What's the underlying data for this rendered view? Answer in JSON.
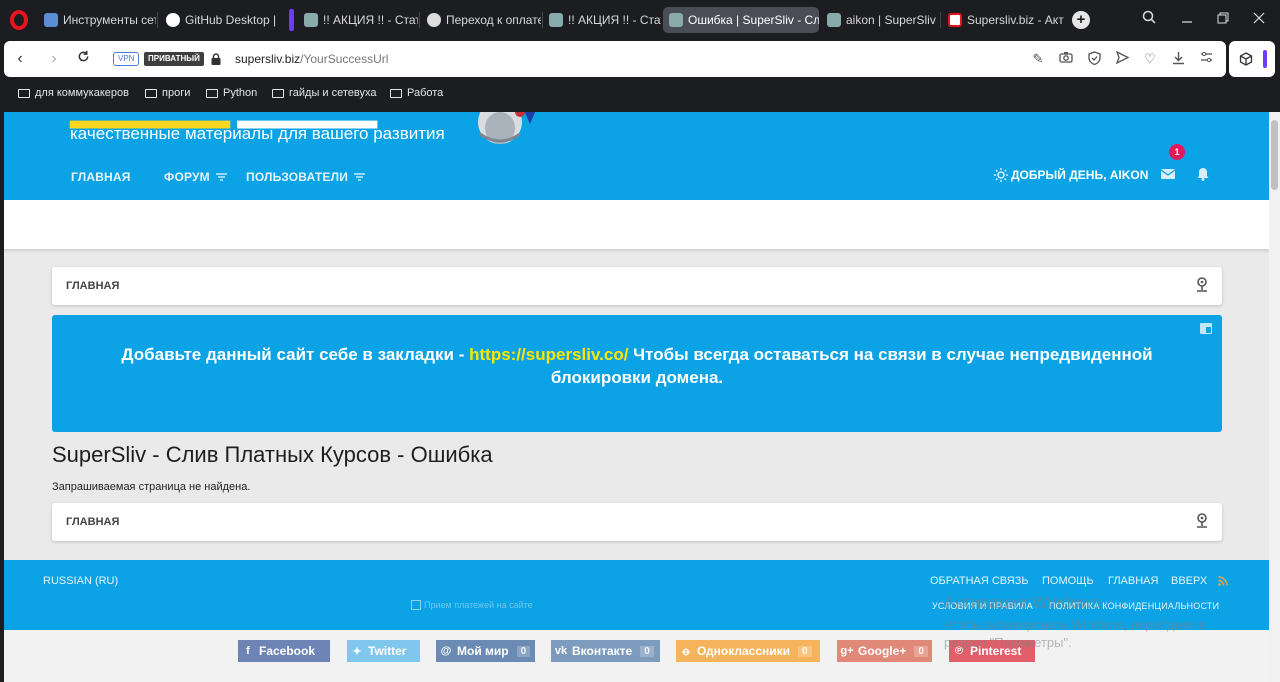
{
  "browser": {
    "tabs": [
      {
        "label": "Инструменты сете",
        "active": false
      },
      {
        "label": "GitHub Desktop | S",
        "active": false
      },
      {
        "label": "!! АКЦИЯ !! - Стат",
        "active": false
      },
      {
        "label": "Переход к оплате",
        "active": false
      },
      {
        "label": "!! АКЦИЯ !! - Стат",
        "active": false
      },
      {
        "label": "Ошибка | SuperSliv - Слив",
        "active": true
      },
      {
        "label": "aikon | SuperSliv -",
        "active": false
      },
      {
        "label": "Supersliv.biz - Акт",
        "active": false
      }
    ],
    "vpn_label": "VPN",
    "private_label": "ПРИВАТНЫЙ",
    "url_host": "supersliv.biz",
    "url_path": "/YourSuccessUrl",
    "bookmarks": [
      {
        "label": "для коммукакеров"
      },
      {
        "label": "проги"
      },
      {
        "label": "Python"
      },
      {
        "label": "гайды и сетевуха"
      },
      {
        "label": "Работа"
      }
    ]
  },
  "header": {
    "tagline": "качественные материалы для вашего развития",
    "nav": {
      "home": "ГЛАВНАЯ",
      "forum": "ФОРУМ",
      "users": "ПОЛЬЗОВАТЕЛИ"
    },
    "greeting": "ДОБРЫЙ ДЕНЬ, AIKON",
    "notification_count": "1"
  },
  "breadcrumb": {
    "label": "ГЛАВНАЯ"
  },
  "notice": {
    "text_before": "Добавьте данный сайт себе в закладки - ",
    "link": "https://supersliv.co/",
    "text_after": " Чтобы всегда оставаться на связи в случае непредвиденной блокировки домена."
  },
  "page": {
    "title": "SuperSliv - Слив Платных Курсов - Ошибка",
    "message": "Запрашиваемая страница не найдена."
  },
  "footer": {
    "language": "RUSSIAN (RU)",
    "links": {
      "feedback": "ОБРАТНАЯ СВЯЗЬ",
      "help": "ПОМОЩЬ",
      "home": "ГЛАВНАЯ",
      "top": "ВВЕРХ"
    },
    "links2": {
      "terms": "УСЛОВИЯ И ПРАВИЛА",
      "privacy": "ПОЛИТИКА КОНФИДЕНЦИАЛЬНОСТИ"
    },
    "payment_alt": "Прием платежей на сайте"
  },
  "share": [
    {
      "label": "Facebook",
      "count": "",
      "color": "#6d84b4"
    },
    {
      "label": "Twitter",
      "count": "",
      "color": "#7fc7ec"
    },
    {
      "label": "Мой мир",
      "count": "0",
      "color": "#6b8bb4"
    },
    {
      "label": "Вконтакте",
      "count": "0",
      "color": "#7d9bbd"
    },
    {
      "label": "Одноклассники",
      "count": "0",
      "color": "#f5b35b"
    },
    {
      "label": "Google+",
      "count": "0",
      "color": "#e08979"
    },
    {
      "label": "Pinterest",
      "count": "",
      "color": "#e15e6a"
    }
  ],
  "watermark": {
    "title": "Активация Windows",
    "line": "Чтобы активировать Windows, перейдите в раздел \"Параметры\"."
  },
  "colors": {
    "brand_blue": "#0ba3e6",
    "link_yellow": "#ffe600",
    "badge_red": "#e5195a",
    "opera_red": "#e8141e"
  }
}
